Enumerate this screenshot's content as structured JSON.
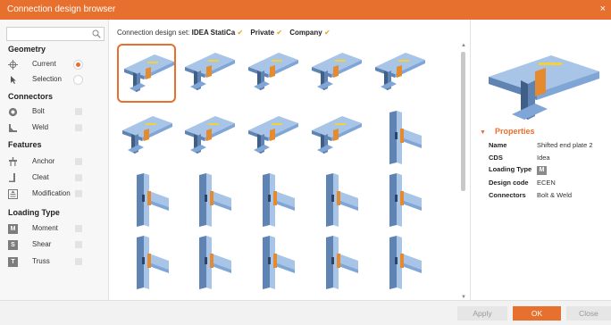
{
  "window": {
    "title": "Connection design browser",
    "close_glyph": "×"
  },
  "sidebar": {
    "search": {
      "placeholder": "",
      "value": "",
      "icon": "search-icon"
    },
    "geometry": {
      "heading": "Geometry",
      "items": [
        {
          "label": "Current",
          "selected": true
        },
        {
          "label": "Selection",
          "selected": false
        }
      ]
    },
    "connectors": {
      "heading": "Connectors",
      "items": [
        {
          "label": "Bolt"
        },
        {
          "label": "Weld"
        }
      ]
    },
    "features": {
      "heading": "Features",
      "items": [
        {
          "label": "Anchor"
        },
        {
          "label": "Cleat"
        },
        {
          "label": "Modification"
        }
      ]
    },
    "loading_type": {
      "heading": "Loading Type",
      "items": [
        {
          "label": "Moment",
          "letter": "M"
        },
        {
          "label": "Shear",
          "letter": "S"
        },
        {
          "label": "Truss",
          "letter": "T"
        }
      ]
    }
  },
  "cds": {
    "label": "Connection design set:",
    "sets": [
      {
        "name": "IDEA StatiCa",
        "checked": "✔"
      },
      {
        "name": "Private",
        "checked": "✔"
      },
      {
        "name": "Company",
        "checked": "✔"
      }
    ]
  },
  "grid": {
    "selected_index": 0,
    "columns": 5
  },
  "properties": {
    "heading": "Properties",
    "name_label": "Name",
    "name_value": "Shifted end plate 2",
    "cds_label": "CDS",
    "cds_value": "Idea",
    "loading_label": "Loading Type",
    "loading_value": "M",
    "code_label": "Design code",
    "code_value": "ECEN",
    "conn_label": "Connectors",
    "conn_value": "Bolt & Weld"
  },
  "buttons": {
    "apply": "Apply",
    "ok": "OK",
    "close": "Close"
  },
  "colors": {
    "accent": "#e8702e",
    "steel": "#7fa6d6",
    "steel_dark": "#3f5f86",
    "plate": "#e58a2f"
  }
}
